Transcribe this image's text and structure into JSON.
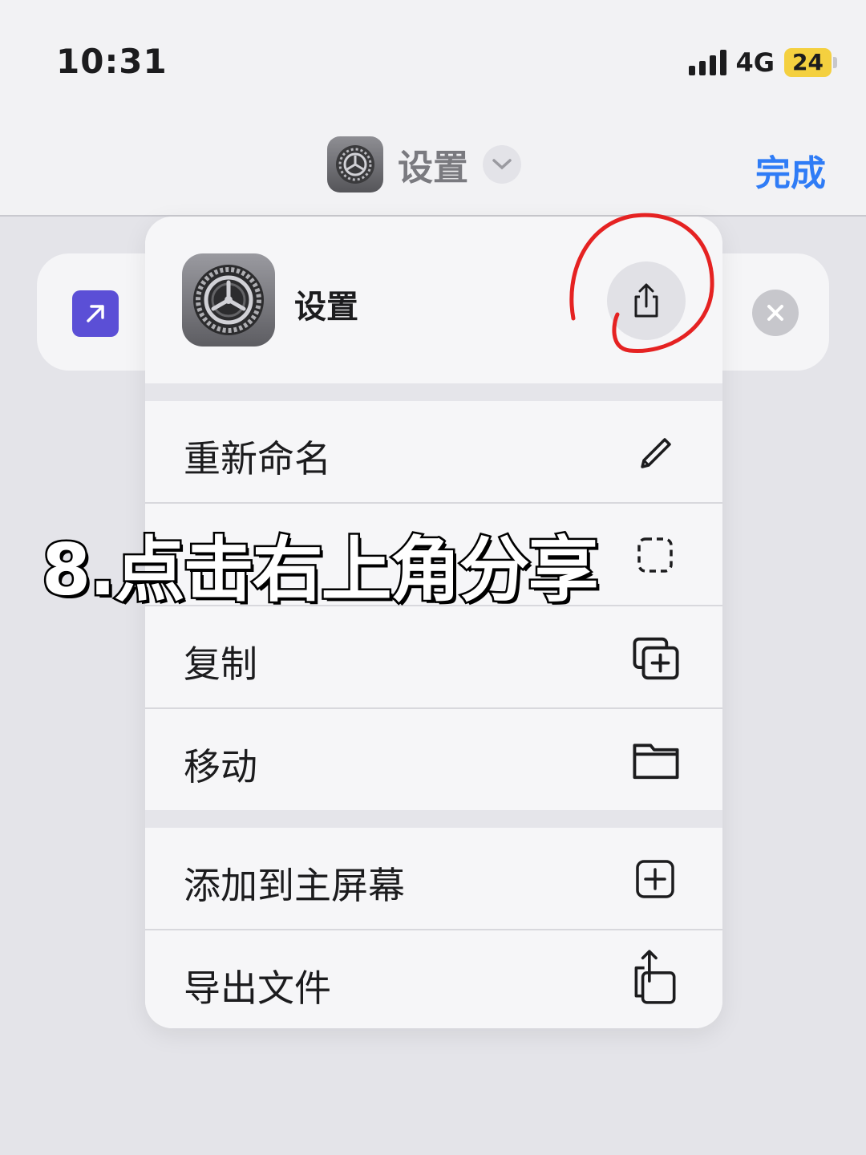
{
  "status_bar": {
    "time": "10:31",
    "network": "4G",
    "battery": "24"
  },
  "nav": {
    "title": "设置",
    "done_label": "完成"
  },
  "menu": {
    "app_name": "设置",
    "items": [
      {
        "label": "重新命名",
        "icon": "pencil-icon"
      },
      {
        "label": "",
        "icon": "dashed-square-icon"
      },
      {
        "label": "复制",
        "icon": "duplicate-icon"
      },
      {
        "label": "移动",
        "icon": "folder-icon"
      },
      {
        "label": "添加到主屏幕",
        "icon": "add-square-icon"
      },
      {
        "label": "导出文件",
        "icon": "export-icon"
      }
    ]
  },
  "caption": "8.点击右上角分享",
  "colors": {
    "accent": "#2f7cf6",
    "annotation": "#e52222",
    "shortcut_icon": "#5b4fd6"
  }
}
